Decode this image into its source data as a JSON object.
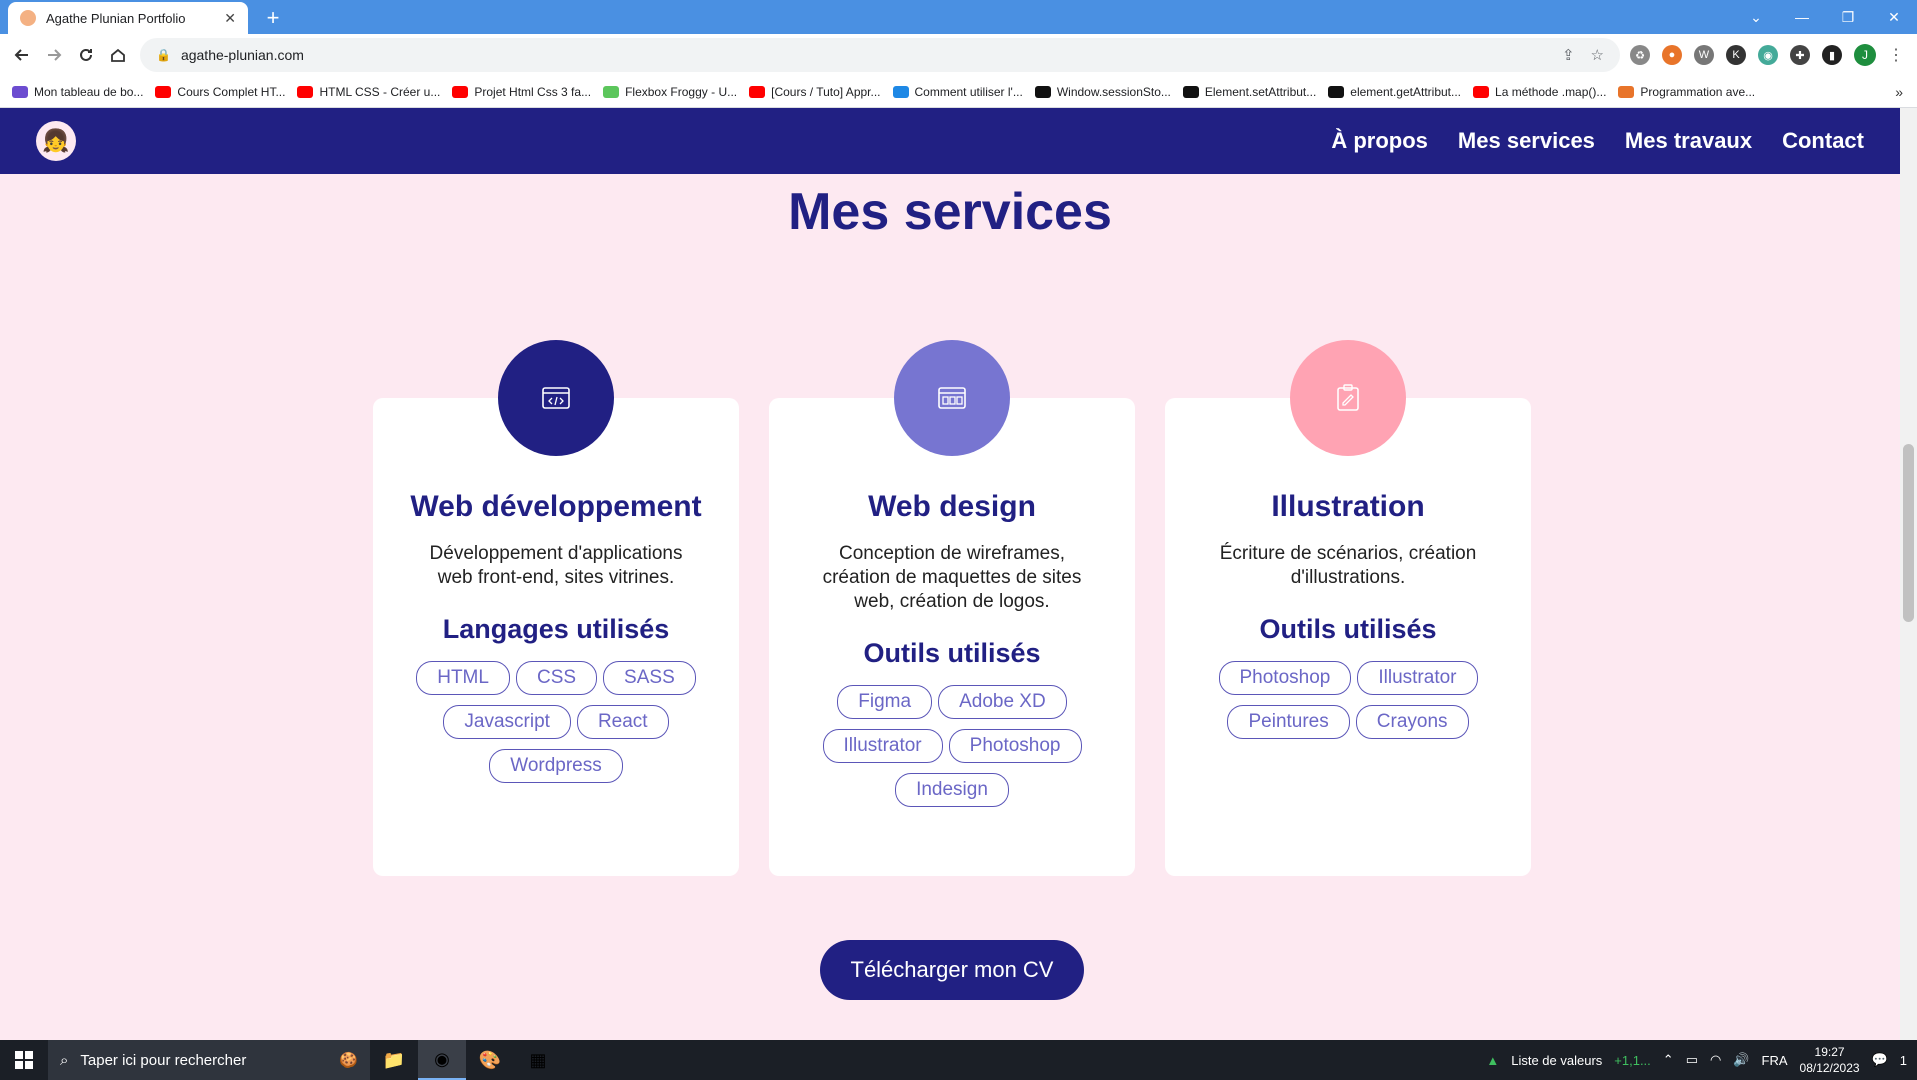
{
  "browser": {
    "tab_title": "Agathe Plunian Portfolio",
    "tab_close": "✕",
    "new_tab": "+",
    "url": "agathe-plunian.com",
    "window_controls": [
      "⌄",
      "—",
      "❐",
      "✕"
    ],
    "profile_initial": "J"
  },
  "bookmarks": [
    {
      "label": "Mon tableau de bo...",
      "color": "#6c4cd0"
    },
    {
      "label": "Cours Complet HT...",
      "color": "#ff0000"
    },
    {
      "label": "HTML CSS - Créer u...",
      "color": "#ff0000"
    },
    {
      "label": "Projet Html Css 3 fa...",
      "color": "#ff0000"
    },
    {
      "label": "Flexbox Froggy - U...",
      "color": "#5cc65c"
    },
    {
      "label": "[Cours / Tuto] Appr...",
      "color": "#ff0000"
    },
    {
      "label": "Comment utiliser l'...",
      "color": "#1e88e5"
    },
    {
      "label": "Window.sessionSto...",
      "color": "#111111"
    },
    {
      "label": "Element.setAttribut...",
      "color": "#111111"
    },
    {
      "label": "element.getAttribut...",
      "color": "#111111"
    },
    {
      "label": "La méthode .map()...",
      "color": "#ff0000"
    },
    {
      "label": "Programmation ave...",
      "color": "#e8742a"
    }
  ],
  "site": {
    "nav": {
      "logo": "👧",
      "links": [
        "À propos",
        "Mes services",
        "Mes travaux",
        "Contact"
      ]
    },
    "section_title": "Mes services",
    "cards": [
      {
        "title": "Web développement",
        "description": "Développement d'applications web front-end, sites vitrines.",
        "subtitle": "Langages utilisés",
        "circle_color": "#212083",
        "icon": "code-window-icon",
        "tags": [
          "HTML",
          "CSS",
          "SASS",
          "Javascript",
          "React",
          "Wordpress"
        ]
      },
      {
        "title": "Web design",
        "description": "Conception de wireframes, création de maquettes de sites web, création de logos.",
        "subtitle": "Outils utilisés",
        "circle_color": "#7775d1",
        "icon": "layout-grid-icon",
        "tags": [
          "Figma",
          "Adobe XD",
          "Illustrator",
          "Photoshop",
          "Indesign"
        ]
      },
      {
        "title": "Illustration",
        "description": "Écriture de scénarios, création d'illustrations.",
        "subtitle": "Outils utilisés",
        "circle_color": "#ffa3b3",
        "icon": "clipboard-brush-icon",
        "tags": [
          "Photoshop",
          "Illustrator",
          "Peintures",
          "Crayons"
        ]
      }
    ],
    "cv_button": "Télécharger mon CV"
  },
  "taskbar": {
    "search_placeholder": "Taper ici pour rechercher",
    "stock_label": "Liste de valeurs",
    "stock_value": "+1,1...",
    "language": "FRA",
    "time": "19:27",
    "date": "08/12/2023",
    "notification_count": "1"
  }
}
